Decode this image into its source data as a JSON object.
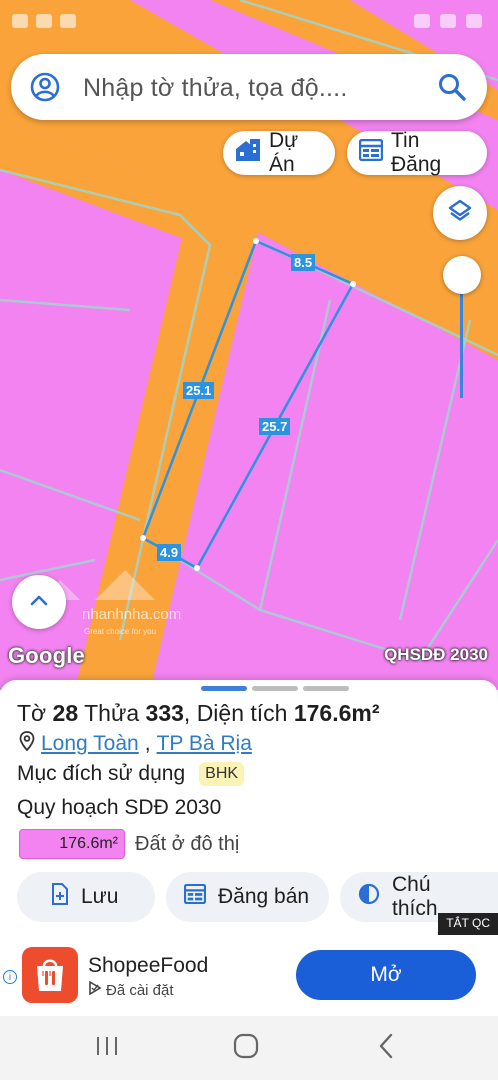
{
  "search": {
    "placeholder": "Nhập tờ thửa, tọa độ...."
  },
  "chips": {
    "du_an": "Dự Án",
    "tin_dang": "Tin Đăng"
  },
  "map": {
    "edge_labels": [
      "8.5",
      "25.1",
      "25.7",
      "4.9"
    ],
    "watermark_text": "nhanhnha.com",
    "watermark_tag": "Great choice for you",
    "google_logo": "Google",
    "layer_label": "QHSDĐ 2030",
    "colors": {
      "land": "#f283f0",
      "road": "#f9a33a",
      "boundary": "#2b93e0"
    }
  },
  "parcel": {
    "to_label": "Tờ",
    "to_value": "28",
    "thua_label": "Thửa",
    "thua_value": "333",
    "dien_tich_label": "Diện tích",
    "dien_tich_value": "176.6m²",
    "ward": "Long Toàn",
    "city": "TP Bà Rịa",
    "purpose_label": "Mục đích sử dụng",
    "purpose_code": "BHK",
    "plan_label": "Quy hoạch SDĐ 2030",
    "area_chip": "176.6m²",
    "area_desc": "Đất ở đô thị"
  },
  "actions": {
    "luu": "Lưu",
    "dang_ban": "Đăng bán",
    "chu_thich": "Chú thích"
  },
  "ad": {
    "close_label": "TẮT QC",
    "app_name": "ShopeeFood",
    "status": "Đã cài đặt",
    "open_label": "Mở",
    "info_glyph": "i"
  }
}
